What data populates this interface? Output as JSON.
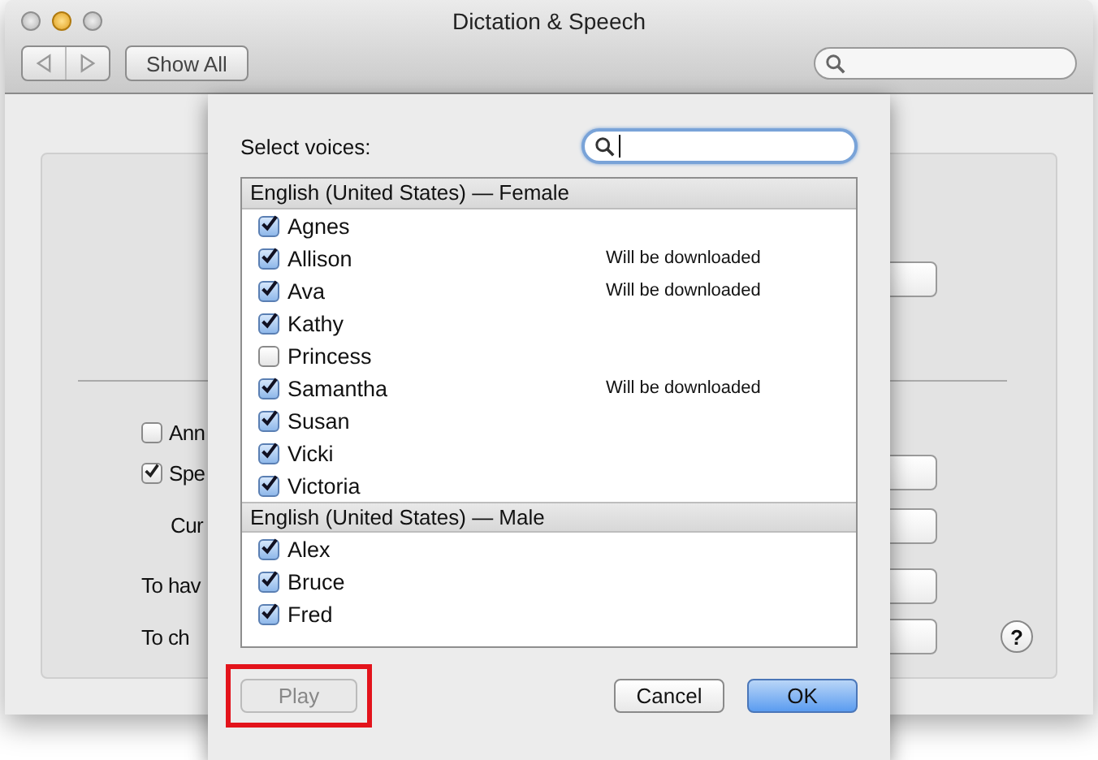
{
  "window": {
    "title": "Dictation & Speech"
  },
  "toolbar": {
    "show_all": "Show All"
  },
  "background": {
    "rows": [
      {
        "kind": "checkbox",
        "label": "Ann",
        "checked": false
      },
      {
        "kind": "checkbox",
        "label": "Spe",
        "checked": true
      },
      {
        "kind": "text",
        "label": "Cur"
      },
      {
        "kind": "text",
        "label": "To hav"
      },
      {
        "kind": "text",
        "label": "To ch"
      }
    ],
    "help": "?"
  },
  "sheet": {
    "label": "Select voices:",
    "groups": [
      {
        "title": "English (United States) — Female",
        "voices": [
          {
            "name": "Agnes",
            "checked": true
          },
          {
            "name": "Allison",
            "checked": true,
            "note": "Will be downloaded"
          },
          {
            "name": "Ava",
            "checked": true,
            "note": "Will be downloaded"
          },
          {
            "name": "Kathy",
            "checked": true
          },
          {
            "name": "Princess",
            "checked": false
          },
          {
            "name": "Samantha",
            "checked": true,
            "note": "Will be downloaded"
          },
          {
            "name": "Susan",
            "checked": true
          },
          {
            "name": "Vicki",
            "checked": true
          },
          {
            "name": "Victoria",
            "checked": true
          }
        ]
      },
      {
        "title": "English (United States) — Male",
        "voices": [
          {
            "name": "Alex",
            "checked": true
          },
          {
            "name": "Bruce",
            "checked": true
          },
          {
            "name": "Fred",
            "checked": true
          }
        ]
      }
    ],
    "buttons": [
      {
        "label": "Play",
        "kind": "secondary",
        "disabled": true,
        "highlighted": true
      },
      {
        "label": "Cancel",
        "kind": "secondary",
        "disabled": false,
        "highlighted": false
      },
      {
        "label": "OK",
        "kind": "default",
        "disabled": false,
        "highlighted": false
      }
    ]
  }
}
